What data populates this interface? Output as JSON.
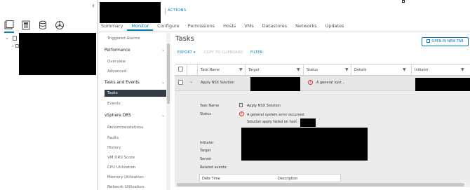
{
  "header": {
    "actions_label": "ACTIONS",
    "tabs": [
      "Summary",
      "Monitor",
      "Configure",
      "Permissions",
      "Hosts",
      "VMs",
      "Datastores",
      "Networks",
      "Updates"
    ],
    "active_tab": "Monitor"
  },
  "left_nav": {
    "collapse_glyph": "‹",
    "icons": [
      "hosts-and-clusters-icon",
      "vms-and-templates-icon",
      "storage-icon",
      "networking-icon"
    ],
    "tree_expanders": [
      "⌄",
      "›"
    ]
  },
  "monitor_nav": {
    "items": [
      {
        "label": "Triggered Alarms",
        "type": "item"
      },
      {
        "label": "Performance",
        "type": "group"
      },
      {
        "label": "Overview",
        "type": "item"
      },
      {
        "label": "Advanced",
        "type": "item"
      },
      {
        "label": "Tasks and Events",
        "type": "group"
      },
      {
        "label": "Tasks",
        "type": "item",
        "selected": true
      },
      {
        "label": "Events",
        "type": "item"
      },
      {
        "label": "vSphere DRS",
        "type": "group"
      },
      {
        "label": "Recommendations",
        "type": "item"
      },
      {
        "label": "Faults",
        "type": "item"
      },
      {
        "label": "History",
        "type": "item"
      },
      {
        "label": "VM DRS Score",
        "type": "item"
      },
      {
        "label": "CPU Utilization",
        "type": "item"
      },
      {
        "label": "Memory Utilization",
        "type": "item"
      },
      {
        "label": "Network Utilization",
        "type": "item"
      }
    ]
  },
  "main": {
    "title": "Tasks",
    "open_new_tab": "OPEN IN NEW TAB",
    "toolbar": {
      "export": "EXPORT ▾",
      "copy": "COPY TO CLIPBOARD",
      "filter": "FILTER"
    },
    "columns": [
      "Task Name",
      "Target",
      "Status",
      "Details",
      "Initiator"
    ],
    "row": {
      "task_name": "Apply NSX Solution",
      "status": "A general syst..."
    },
    "detail": {
      "labels": {
        "task_name": "Task Name",
        "status": "Status",
        "initiator": "Initiator",
        "target": "Target",
        "server": "Server",
        "related_events": "Related events:"
      },
      "task_name_value": "Apply NSX Solution",
      "status_value": "A general system error occurred:",
      "status_detail": "Solution apply failed on host",
      "events_columns": [
        "Date Time",
        "Description"
      ]
    }
  },
  "colors": {
    "accent": "#0079b8",
    "error": "#d9322b",
    "selected_nav": "#313c48"
  }
}
